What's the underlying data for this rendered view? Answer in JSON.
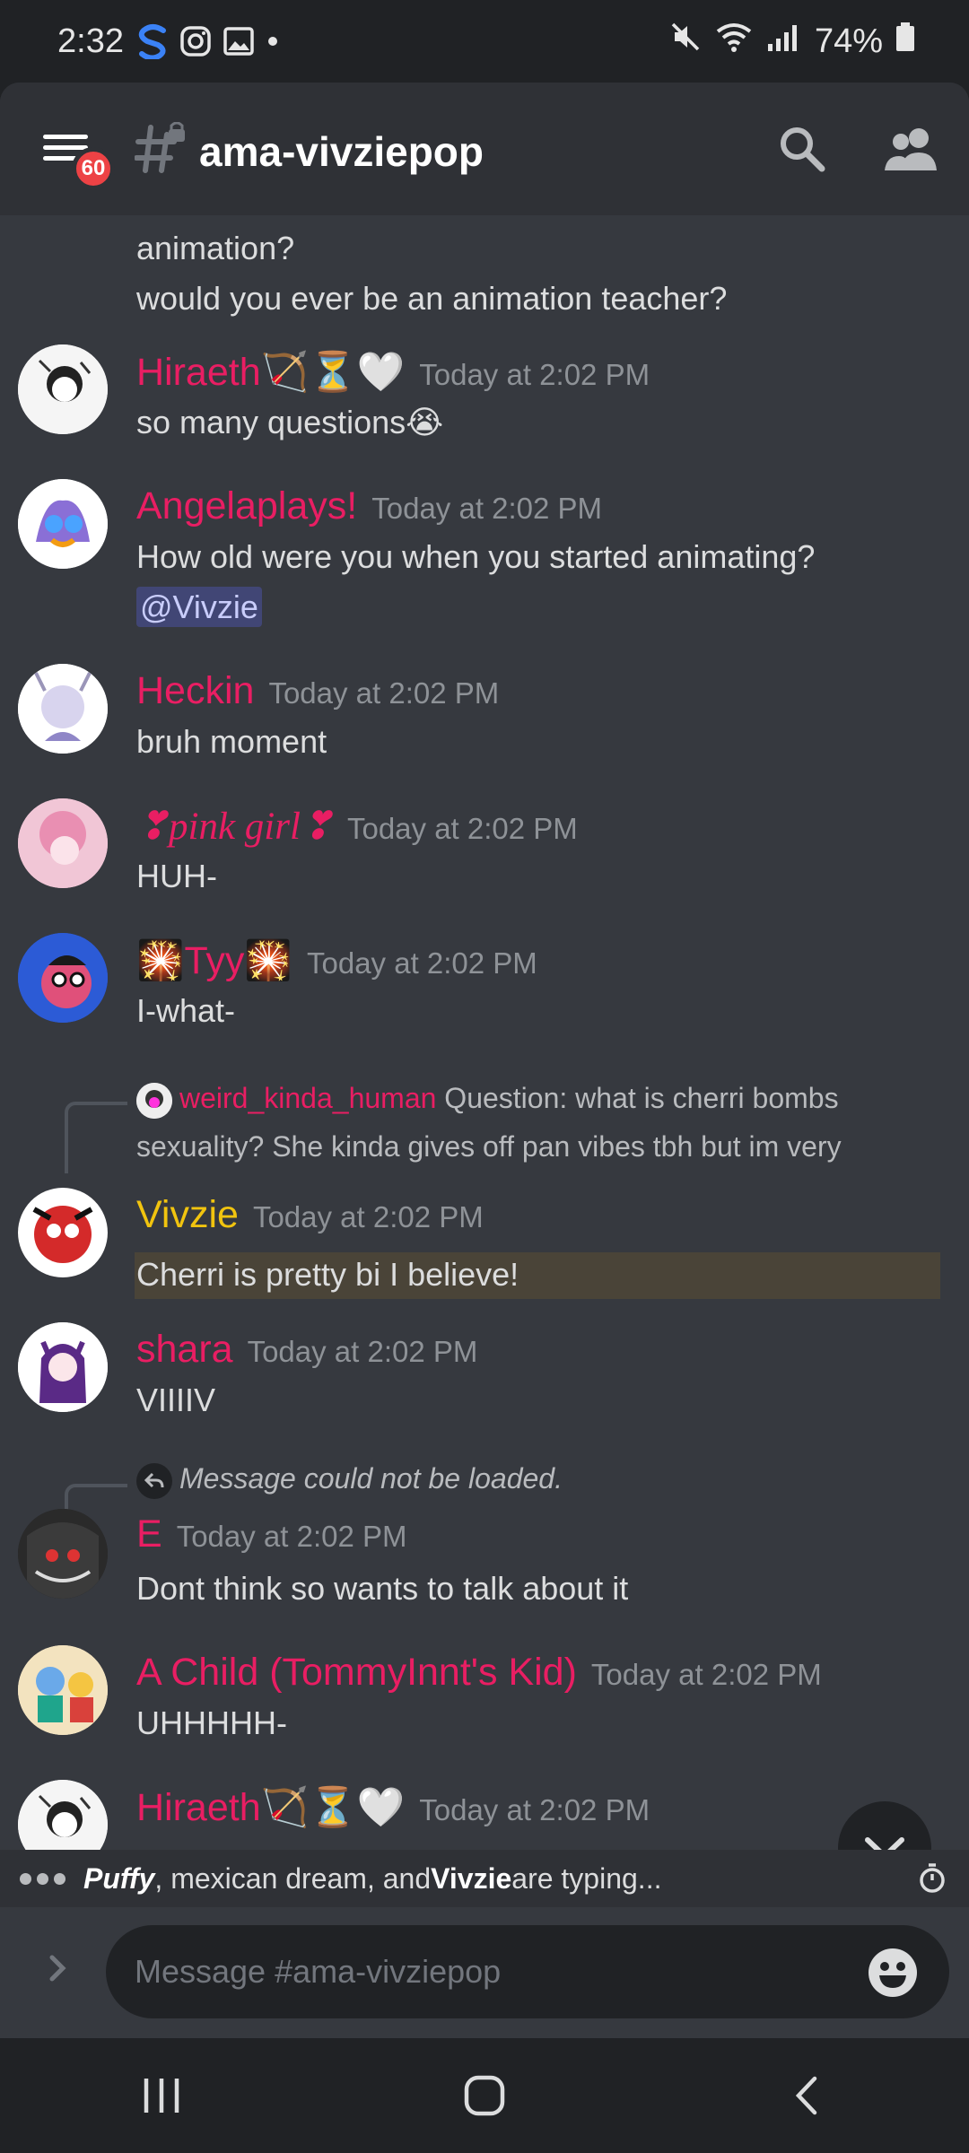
{
  "status": {
    "time": "2:32",
    "battery": "74%"
  },
  "header": {
    "badge": "60",
    "channel": "ama-vivziepop"
  },
  "messages": [
    {
      "continuation": [
        "animation?",
        " would you ever be an animation teacher?"
      ]
    },
    {
      "author": "Hiraeth🏹⏳🤍",
      "color": "#e91e63",
      "time": "Today at 2:02 PM",
      "text": "so many questions😭"
    },
    {
      "author": "Angelaplays!",
      "color": "#e91e63",
      "time": "Today at 2:02 PM",
      "text": "How old were you when you started animating?",
      "mention": "@Vivzie"
    },
    {
      "author": "Heckin",
      "color": "#e91e63",
      "time": "Today at 2:02 PM",
      "text": "bruh moment"
    },
    {
      "author": "❣pink girl❣",
      "color": "#e91e63",
      "time": "Today at 2:02 PM",
      "text": "HUH-"
    },
    {
      "author": "🎇Tyy🎇",
      "color": "#e91e63",
      "time": "Today at 2:02 PM",
      "text": "I-what-"
    },
    {
      "reply_author": "weird_kinda_human",
      "reply_text_1": "Question: what is cherri bombs",
      "reply_text_2": "sexuality? She kinda gives off pan vibes tbh but im very",
      "author": "Vivzie",
      "color": "#f1c40f",
      "time": "Today at 2:02 PM",
      "text": "Cherri is pretty bi I believe!"
    },
    {
      "author": "shara",
      "color": "#e91e63",
      "time": "Today at 2:02 PM",
      "text": "VIIIIV"
    },
    {
      "reply_text": "Message could not be loaded.",
      "author": "E",
      "color": "#e91e63",
      "time": "Today at 2:02 PM",
      "text": "Dont think so wants to talk about it"
    },
    {
      "author": "A Child (TommyInnt's Kid)",
      "color": "#e91e63",
      "time": "Today at 2:02 PM",
      "text": "UHHHHH-"
    },
    {
      "author": "Hiraeth🏹⏳🤍",
      "color": "#e91e63",
      "time": "Today at 2:02 PM"
    }
  ],
  "typing": {
    "user1": "Puffy",
    "sep1": ", mexican dream, and ",
    "user3": "Vivzie",
    "suffix": " are typing..."
  },
  "composer": {
    "placeholder": "Message #ama-vivziepop"
  },
  "colors": {
    "background": "#36393f",
    "header": "#2f3136",
    "username": "#e91e63",
    "vivzie": "#f1c40f",
    "mention_bg": "#414675"
  }
}
